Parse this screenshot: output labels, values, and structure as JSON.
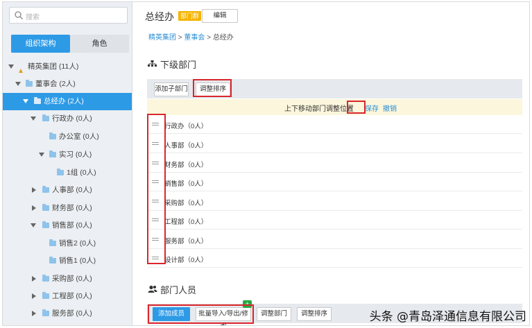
{
  "sidebar": {
    "search_placeholder": "搜索",
    "tabs": [
      "组织架构",
      "角色"
    ],
    "tree": [
      {
        "label": "精英集团 (11人)"
      },
      {
        "label": "董事会 (2人)"
      },
      {
        "label": "总经办 (2人)"
      },
      {
        "label": "行政办 (0人)"
      },
      {
        "label": "办公室 (0人)"
      },
      {
        "label": "实习 (0人)"
      },
      {
        "label": "1组 (0人)"
      },
      {
        "label": "人事部 (0人)"
      },
      {
        "label": "财务部 (0人)"
      },
      {
        "label": "销售部 (0人)"
      },
      {
        "label": "销售2 (0人)"
      },
      {
        "label": "销售1 (0人)"
      },
      {
        "label": "采购部 (0人)"
      },
      {
        "label": "工程部 (0人)"
      },
      {
        "label": "服务部 (0人)"
      }
    ]
  },
  "header": {
    "title": "总经办",
    "badge": "部门群",
    "edit_label": "编辑"
  },
  "breadcrumb": [
    "精英集团",
    "董事会",
    "总经办"
  ],
  "sub_departments": {
    "title": "下级部门",
    "add_label": "添加子部门",
    "sort_label": "调整排序",
    "hint": "上下移动部门调整位置",
    "save_label": "保存",
    "cancel_label": "撤销",
    "rows": [
      "行政办（0人）",
      "人事部（0人）",
      "财务部（0人）",
      "销售部（0人）",
      "采购部（0人）",
      "工程部（0人）",
      "服务部（0人）",
      "设计部（0人）"
    ]
  },
  "members": {
    "title": "部门人员",
    "buttons": [
      "添加成员",
      "批量导入/导出/修改",
      "调整部门",
      "调整排序"
    ],
    "plus": "+"
  },
  "watermark": "头条 @青岛泽通信息有限公司",
  "colors": {
    "accent": "#2d9ae6",
    "highlight": "#d9262c",
    "badge": "#f5b400"
  }
}
